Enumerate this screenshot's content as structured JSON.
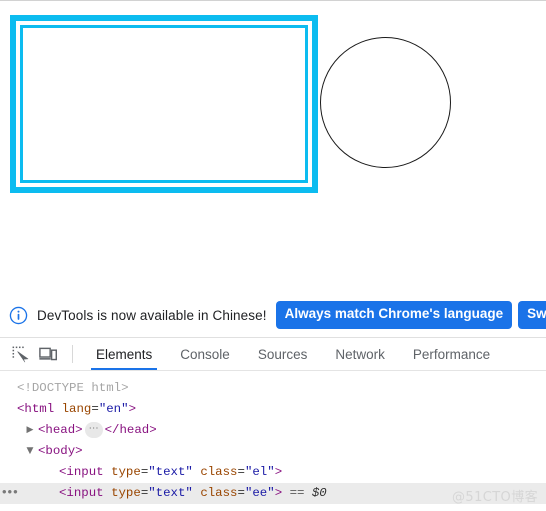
{
  "colors": {
    "highlight_cyan": "#0cbcf0",
    "banner_button_blue": "#1a73e8",
    "tab_underline_blue": "#1a73e8",
    "circle_stroke": "#1a1a1a",
    "selected_row_bg": "#ebebeb",
    "watermark": "#d6d6d6"
  },
  "viewport": {
    "elements": [
      {
        "name": "text-input-el",
        "class": "el",
        "type": "text",
        "shape": "rectangle",
        "highlighted": true
      },
      {
        "name": "text-input-ee",
        "class": "ee",
        "type": "text",
        "shape": "circle",
        "highlighted": false
      }
    ]
  },
  "devtools": {
    "banner": {
      "icon": "info-circle-icon",
      "message": "DevTools is now available in Chinese!",
      "buttons": [
        {
          "label": "Always match Chrome's language"
        },
        {
          "label": "Sw"
        }
      ]
    },
    "toolbar": {
      "icons": [
        {
          "name": "inspect-element-icon"
        },
        {
          "name": "device-toolbar-icon"
        }
      ]
    },
    "tabs": [
      {
        "label": "Elements",
        "active": true
      },
      {
        "label": "Console",
        "active": false
      },
      {
        "label": "Sources",
        "active": false
      },
      {
        "label": "Network",
        "active": false
      },
      {
        "label": "Performance",
        "active": false
      }
    ],
    "dom_tree": [
      {
        "indent": 0,
        "twisty": "",
        "selected": false,
        "gutter_dots": false,
        "tokens": [
          {
            "t": "doctype",
            "v": "<!DOCTYPE html>"
          }
        ]
      },
      {
        "indent": 0,
        "twisty": "",
        "selected": false,
        "gutter_dots": false,
        "tokens": [
          {
            "t": "tag",
            "v": "<html"
          },
          {
            "t": "space",
            "v": " "
          },
          {
            "t": "attr",
            "v": "lang"
          },
          {
            "t": "punct",
            "v": "="
          },
          {
            "t": "val",
            "v": "\"en\""
          },
          {
            "t": "tag",
            "v": ">"
          }
        ]
      },
      {
        "indent": 1,
        "twisty": "collapsed",
        "selected": false,
        "gutter_dots": false,
        "tokens": [
          {
            "t": "tag",
            "v": "<head>"
          },
          {
            "t": "badge",
            "v": "⋯"
          },
          {
            "t": "tag",
            "v": "</head>"
          }
        ]
      },
      {
        "indent": 1,
        "twisty": "expanded",
        "selected": false,
        "gutter_dots": false,
        "tokens": [
          {
            "t": "tag",
            "v": "<body>"
          }
        ]
      },
      {
        "indent": 2,
        "twisty": "",
        "selected": false,
        "gutter_dots": false,
        "tokens": [
          {
            "t": "tag",
            "v": "<input"
          },
          {
            "t": "space",
            "v": " "
          },
          {
            "t": "attr",
            "v": "type"
          },
          {
            "t": "punct",
            "v": "="
          },
          {
            "t": "val",
            "v": "\"text\""
          },
          {
            "t": "space",
            "v": " "
          },
          {
            "t": "attr",
            "v": "class"
          },
          {
            "t": "punct",
            "v": "="
          },
          {
            "t": "val",
            "v": "\"el\""
          },
          {
            "t": "tag",
            "v": ">"
          }
        ]
      },
      {
        "indent": 2,
        "twisty": "",
        "selected": true,
        "gutter_dots": true,
        "tokens": [
          {
            "t": "tag",
            "v": "<input"
          },
          {
            "t": "space",
            "v": " "
          },
          {
            "t": "attr",
            "v": "type"
          },
          {
            "t": "punct",
            "v": "="
          },
          {
            "t": "val",
            "v": "\"text\""
          },
          {
            "t": "space",
            "v": " "
          },
          {
            "t": "attr",
            "v": "class"
          },
          {
            "t": "punct",
            "v": "="
          },
          {
            "t": "val",
            "v": "\"ee\""
          },
          {
            "t": "tag",
            "v": ">"
          },
          {
            "t": "space",
            "v": " "
          },
          {
            "t": "sel",
            "v": "=="
          },
          {
            "t": "space",
            "v": " "
          },
          {
            "t": "dollar",
            "v": "$0"
          }
        ]
      }
    ]
  },
  "watermark": {
    "text": "@51CTO博客"
  }
}
